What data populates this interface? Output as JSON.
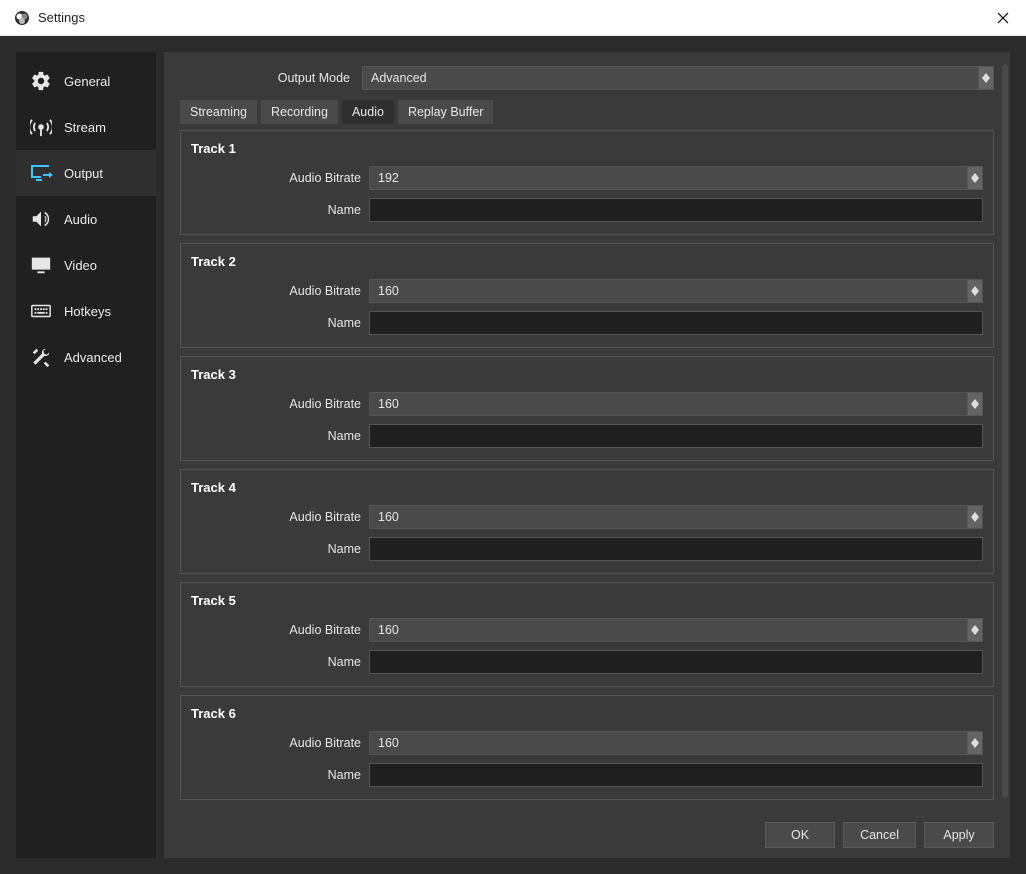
{
  "window": {
    "title": "Settings"
  },
  "sidebar": {
    "items": [
      {
        "label": "General"
      },
      {
        "label": "Stream"
      },
      {
        "label": "Output"
      },
      {
        "label": "Audio"
      },
      {
        "label": "Video"
      },
      {
        "label": "Hotkeys"
      },
      {
        "label": "Advanced"
      }
    ]
  },
  "main": {
    "output_mode_label": "Output Mode",
    "output_mode_value": "Advanced",
    "tabs": [
      {
        "label": "Streaming"
      },
      {
        "label": "Recording"
      },
      {
        "label": "Audio"
      },
      {
        "label": "Replay Buffer"
      }
    ],
    "bitrate_label": "Audio Bitrate",
    "name_label": "Name",
    "tracks": [
      {
        "title": "Track 1",
        "bitrate": "192",
        "name": ""
      },
      {
        "title": "Track 2",
        "bitrate": "160",
        "name": ""
      },
      {
        "title": "Track 3",
        "bitrate": "160",
        "name": ""
      },
      {
        "title": "Track 4",
        "bitrate": "160",
        "name": ""
      },
      {
        "title": "Track 5",
        "bitrate": "160",
        "name": ""
      },
      {
        "title": "Track 6",
        "bitrate": "160",
        "name": ""
      }
    ]
  },
  "buttons": {
    "ok": "OK",
    "cancel": "Cancel",
    "apply": "Apply"
  }
}
